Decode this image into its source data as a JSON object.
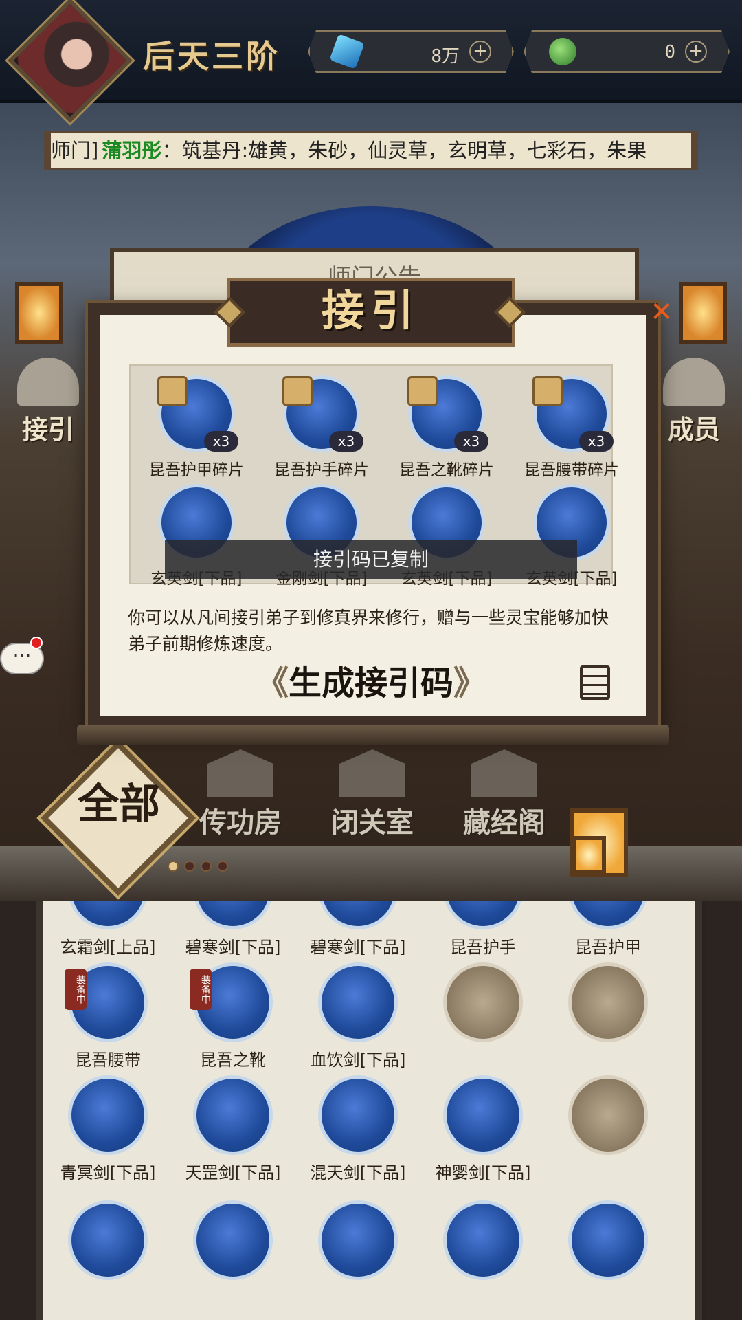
{
  "header": {
    "rank": "后天三阶",
    "currencies": [
      {
        "icon": "gem-icon",
        "value": "8万"
      },
      {
        "icon": "jade-icon",
        "value": "0"
      }
    ]
  },
  "banner": {
    "prefix": "师门]",
    "sender": "蒲羽彤",
    "message": "：筑基丹:雄黄，朱砂，仙灵草，玄明草，七彩石，朱果"
  },
  "notice_board": {
    "title": "师门公告"
  },
  "side_buttons": {
    "left": "接引",
    "right": "成员"
  },
  "rooms": {
    "all": "全部",
    "items": [
      "传功房",
      "闭关室",
      "藏经阁"
    ]
  },
  "pager": {
    "count": 4,
    "active": 0
  },
  "modal": {
    "title": "接引",
    "rewards": [
      {
        "name": "昆吾护甲碎片",
        "count": "x3"
      },
      {
        "name": "昆吾护手碎片",
        "count": "x3"
      },
      {
        "name": "昆吾之靴碎片",
        "count": "x3"
      },
      {
        "name": "昆吾腰带碎片",
        "count": "x3"
      },
      {
        "name": "玄英剑[下品]"
      },
      {
        "name": "金刚剑[下品]"
      },
      {
        "name": "玄英剑[下品]"
      },
      {
        "name": "玄英剑[下品]"
      }
    ],
    "toast": "接引码已复制",
    "description": "你可以从凡间接引弟子到修真界来修行，赠与一些灵宝能够加快弟子前期修炼速度。",
    "generate_button": "生成接引码",
    "generate_brackets": [
      "《",
      "》"
    ]
  },
  "inventory": {
    "equipped_badge": "装备中",
    "items": [
      {
        "name": "玄霜剑[上品]",
        "equipped": true
      },
      {
        "name": "碧寒剑[下品]",
        "equipped": true
      },
      {
        "name": "碧寒剑[下品]",
        "equipped": true
      },
      {
        "name": "昆吾护手",
        "equipped": true
      },
      {
        "name": "昆吾护甲",
        "equipped": true
      },
      {
        "name": "昆吾腰带",
        "equipped": true
      },
      {
        "name": "昆吾之靴",
        "equipped": true
      },
      {
        "name": "血饮剑[下品]"
      },
      {
        "name": "",
        "empty": true
      },
      {
        "name": "",
        "empty": true
      },
      {
        "name": "青冥剑[下品]"
      },
      {
        "name": "天罡剑[下品]"
      },
      {
        "name": "混天剑[下品]"
      },
      {
        "name": "神婴剑[下品]"
      },
      {
        "name": "",
        "empty": true
      },
      {
        "name": ""
      },
      {
        "name": ""
      },
      {
        "name": ""
      },
      {
        "name": ""
      },
      {
        "name": ""
      }
    ]
  }
}
